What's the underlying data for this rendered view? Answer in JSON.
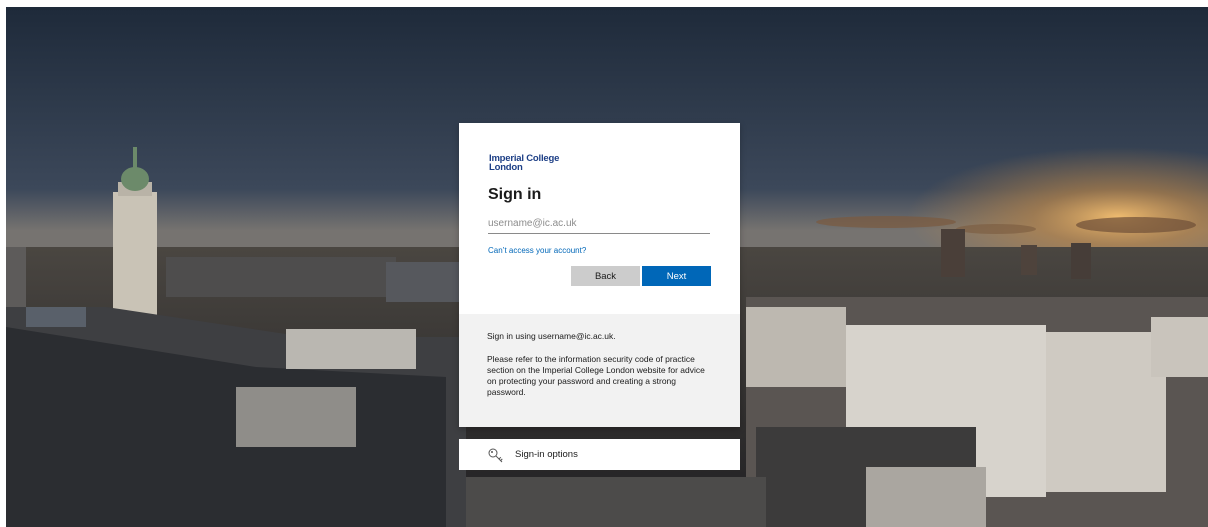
{
  "background": {
    "sky_color": "#2a3647",
    "horizon_color": "#c08f50"
  },
  "card": {
    "logo_line1": "Imperial College",
    "logo_line2": "London",
    "logo_color": "#1d3f86",
    "title": "Sign in",
    "email_placeholder": "username@ic.ac.uk",
    "email_value": "",
    "cant_access_link": "Can’t access your account?",
    "back_button": "Back",
    "next_button": "Next",
    "accent_color": "#0067b8"
  },
  "footer": {
    "line1": "Sign in using username@ic.ac.uk.",
    "line2": "Please refer to the information security code of practice section on the Imperial College London website for advice on protecting your password and creating a strong password."
  },
  "sign_in_options": {
    "icon": "key-icon",
    "label": "Sign-in options"
  }
}
